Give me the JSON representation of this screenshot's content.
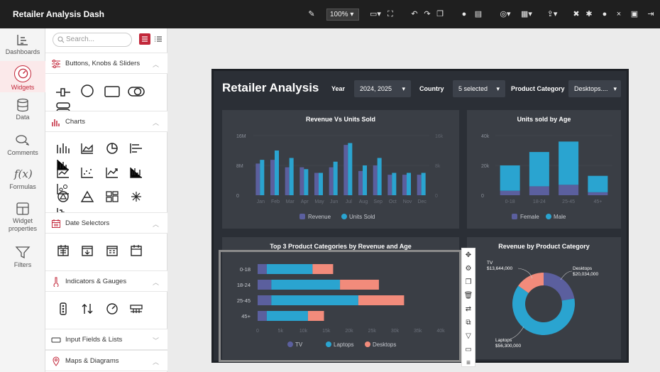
{
  "app": {
    "title": "Retailer Analysis Dash",
    "zoom": "100%"
  },
  "rail": [
    {
      "label": "Dashboards",
      "icon": "dashboards-icon"
    },
    {
      "label": "Widgets",
      "icon": "widgets-icon"
    },
    {
      "label": "Data",
      "icon": "data-icon"
    },
    {
      "label": "Comments",
      "icon": "comments-icon"
    },
    {
      "label": "Formulas",
      "icon": "formulas-icon"
    },
    {
      "label": "Widget properties",
      "icon": "widget-properties-icon"
    },
    {
      "label": "Filters",
      "icon": "filters-icon"
    }
  ],
  "panel": {
    "search_placeholder": "Search...",
    "sections": [
      {
        "label": "Buttons, Knobs & Sliders"
      },
      {
        "label": "Charts"
      },
      {
        "label": "Date Selectors"
      },
      {
        "label": "Indicators & Gauges"
      },
      {
        "label": "Input Fields & Lists"
      },
      {
        "label": "Maps & Diagrams"
      }
    ]
  },
  "dashboard": {
    "title": "Retailer Analysis",
    "filters": [
      {
        "label": "Year",
        "value": "2024, 2025"
      },
      {
        "label": "Country",
        "value": "5 selected"
      },
      {
        "label": "Product Category",
        "value": "Desktops...."
      }
    ]
  },
  "chart_data": [
    {
      "type": "bar",
      "title": "Revenue Vs Units Sold",
      "categories": [
        "Jan",
        "Feb",
        "Mar",
        "Apr",
        "May",
        "Jun",
        "Jul",
        "Aug",
        "Sep",
        "Oct",
        "Nov",
        "Dec"
      ],
      "y_ticks": [
        "16M",
        "8M",
        "0"
      ],
      "y2_ticks": [
        "16k",
        "8k",
        "0"
      ],
      "series": [
        {
          "name": "Revenue",
          "values": [
            8.5,
            9.5,
            7.5,
            7.5,
            6,
            7.5,
            13.5,
            6.5,
            8,
            5.5,
            5.5,
            5.5
          ]
        },
        {
          "name": "Units Sold",
          "values": [
            9.5,
            12,
            10,
            7,
            6,
            9,
            14,
            8,
            10,
            6,
            6,
            6
          ]
        }
      ],
      "colors": {
        "Revenue": "#5b5f9e",
        "Units Sold": "#2aa4d0"
      }
    },
    {
      "type": "bar",
      "title": "Units sold by Age",
      "categories": [
        "0-18",
        "18-24",
        "25-45",
        "45+"
      ],
      "y_ticks": [
        "40k",
        "20k",
        "0"
      ],
      "series": [
        {
          "name": "Female",
          "values": [
            3,
            6,
            7,
            2
          ]
        },
        {
          "name": "Male",
          "values": [
            17,
            23,
            29,
            11
          ]
        }
      ],
      "stacked": true
    },
    {
      "type": "bar",
      "orientation": "horizontal",
      "title": "Top 3 Product Categories by Revenue and Age",
      "categories": [
        "0-18",
        "18-24",
        "25-45",
        "45+"
      ],
      "x_ticks": [
        "0",
        "5k",
        "10k",
        "15k",
        "20k",
        "25k",
        "30k",
        "35k",
        "40k"
      ],
      "series": [
        {
          "name": "TV",
          "values": [
            2,
            3,
            3,
            2
          ]
        },
        {
          "name": "Laptops",
          "values": [
            10,
            15,
            19,
            9
          ]
        },
        {
          "name": "Desktops",
          "values": [
            4.5,
            8.5,
            10,
            3.5
          ]
        }
      ],
      "stacked": true
    },
    {
      "type": "pie",
      "title": "Revenue by Product Category",
      "slices": [
        {
          "name": "TV",
          "value": 13644000,
          "label": "$13,644,000"
        },
        {
          "name": "Desktops",
          "value": 20034000,
          "label": "$20,034,000"
        },
        {
          "name": "Laptops",
          "value": 56300000,
          "label": "$56,300,000"
        }
      ]
    }
  ]
}
